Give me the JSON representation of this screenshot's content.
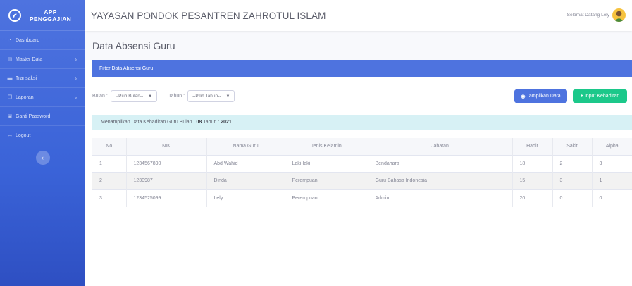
{
  "brand": {
    "line1": "APP",
    "line2": "PENGGAJIAN"
  },
  "sidebar": {
    "items": [
      {
        "label": "Dashboard",
        "icon": "dashboard-icon",
        "submenu": false
      },
      {
        "label": "Master Data",
        "icon": "folder-icon",
        "submenu": true
      },
      {
        "label": "Transaksi",
        "icon": "money-icon",
        "submenu": true
      },
      {
        "label": "Laporan",
        "icon": "copy-icon",
        "submenu": true
      },
      {
        "label": "Ganti Password",
        "icon": "lock-icon",
        "submenu": false
      },
      {
        "label": "Logout",
        "icon": "sign-out-icon",
        "submenu": false
      }
    ],
    "toggle": "‹"
  },
  "topbar": {
    "title": "YAYASAN PONDOK PESANTREN ZAHROTUL ISLAM",
    "greeting": "Selamat Datang Lely"
  },
  "page": {
    "title": "Data Absensi Guru"
  },
  "filter": {
    "header": "Filter Data Absensi Guru",
    "bulan_label": "Bulan :",
    "bulan_value": "--Pilih Bulan--",
    "tahun_label": "Tahun :",
    "tahun_value": "--Pilih Tahun--",
    "show_button": "Tampilkan Data",
    "input_button": "Input Kehadiran"
  },
  "info": {
    "prefix": "Menampilkan Data Kehadiran Guru Bulan :",
    "bulan": "08",
    "middle": "Tahun :",
    "tahun": "2021"
  },
  "table": {
    "columns": [
      "No",
      "NIK",
      "Nama Guru",
      "Jenis Kelamin",
      "Jabatan",
      "Hadir",
      "Sakit",
      "Alpha"
    ],
    "rows": [
      [
        "1",
        "1234567890",
        "Abd Wahid",
        "Laki-laki",
        "Bendahara",
        "18",
        "2",
        "3"
      ],
      [
        "2",
        "1230987",
        "Dinda",
        "Perempuan",
        "Guru Bahasa Indonesia",
        "15",
        "3",
        "1"
      ],
      [
        "3",
        "1234525099",
        "Lely",
        "Perempuan",
        "Admin",
        "20",
        "0",
        "0"
      ]
    ]
  },
  "colors": {
    "primary": "#4e73df",
    "success": "#1cc88a",
    "info_bg": "#d7f1f5"
  }
}
